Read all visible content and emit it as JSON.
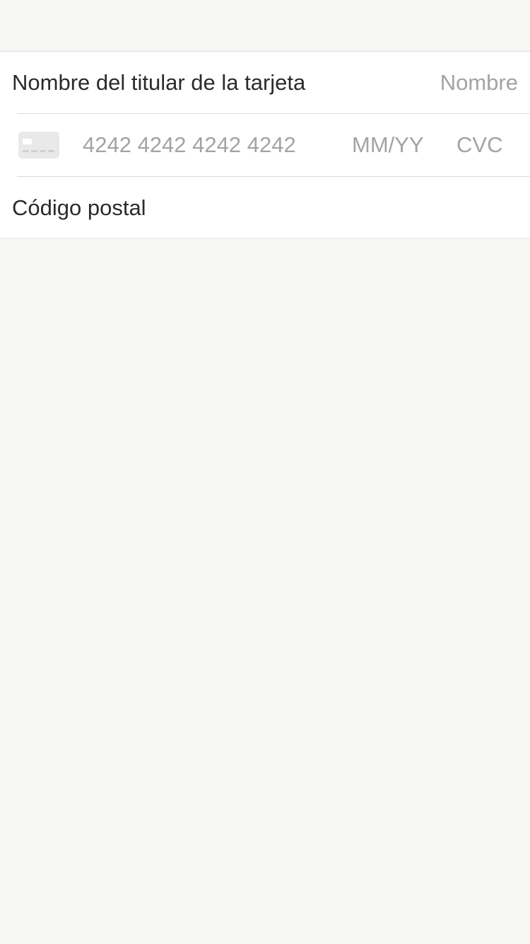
{
  "form": {
    "cardholder": {
      "label": "Nombre del titular de la tarjeta",
      "placeholder": "Nombre",
      "value": ""
    },
    "card": {
      "icon": "credit-card-icon",
      "number_placeholder": "4242 4242 4242 4242",
      "expiry_placeholder": "MM/YY",
      "cvc_placeholder": "CVC"
    },
    "postal": {
      "label": "Código postal",
      "value": ""
    }
  },
  "colors": {
    "background": "#f6f6f4",
    "card_background": "#ffffff",
    "text": "#2b2b2b",
    "placeholder": "#a3a3a3",
    "divider": "#dcdcdc"
  }
}
